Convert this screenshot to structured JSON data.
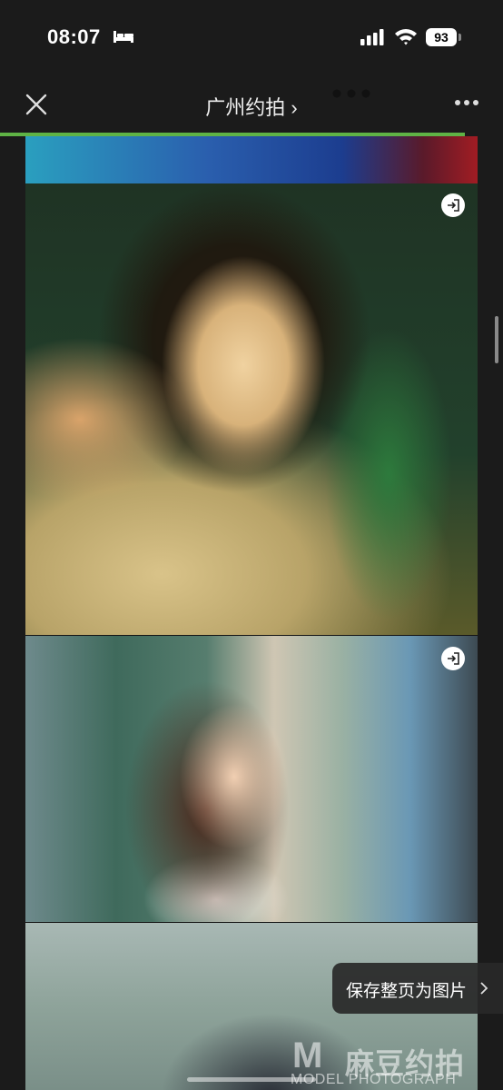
{
  "status_bar": {
    "time": "08:07",
    "battery": "93",
    "icons": [
      "bed-icon",
      "signal-icon",
      "wifi-icon"
    ]
  },
  "navbar": {
    "title": "广州约拍 ›",
    "icons": [
      "close-icon",
      "more-icon"
    ],
    "progress_color": "#5fb345"
  },
  "photos": [
    {
      "name": "photo-partial-top"
    },
    {
      "name": "photo-woman-lying",
      "exit_icon": "exit-icon"
    },
    {
      "name": "photo-woman-profile",
      "exit_icon": "exit-icon"
    },
    {
      "name": "photo-partial-bottom"
    }
  ],
  "save_button": {
    "label": "保存整页为图片"
  },
  "watermark": {
    "logo_letter": "M",
    "text_cn": "麻豆约拍",
    "text_en": "MODEL PHOTOGRAPH"
  }
}
